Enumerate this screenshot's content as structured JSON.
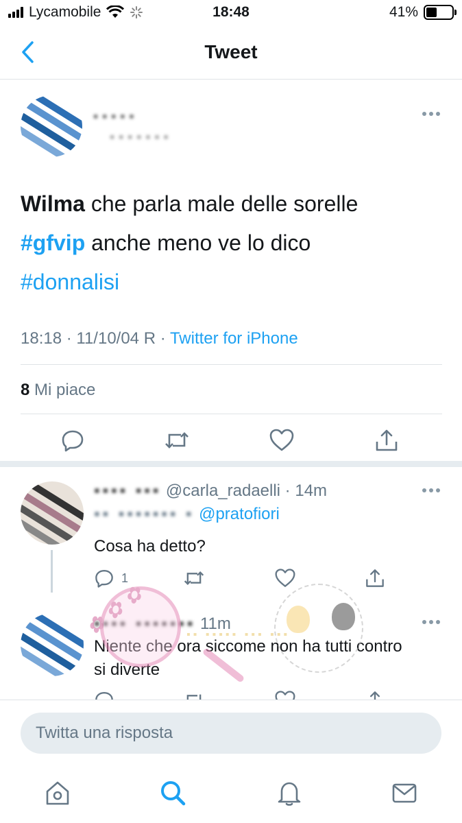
{
  "status_bar": {
    "carrier": "Lycamobile",
    "time": "18:48",
    "battery_percent": "41%",
    "battery_level": 0.41
  },
  "nav": {
    "title": "Tweet"
  },
  "tweet": {
    "text_bold": "Wilma",
    "text_line1_rest": " che parla male delle sorelle",
    "hashtag_gfvip": "#gfvip",
    "text_line2_rest": " anche meno ve lo dico",
    "hashtag_donnalisi": "#donnalisi",
    "timestamp": "18:18 · 11/10/04 R",
    "separator": " · ",
    "source": "Twitter for iPhone",
    "likes_count": "8",
    "likes_label": " Mi piace"
  },
  "replies": [
    {
      "handle": "@carla_radaelli",
      "time_sep": " · ",
      "time": "14m",
      "reply_to_mention": "@pratofiori",
      "text": "Cosa ha detto?",
      "reply_count": "1"
    },
    {
      "time": "11m",
      "text": "Niente che ora siccome non ha tutti contro si diverte"
    }
  ],
  "composer": {
    "placeholder": "Twitta una risposta"
  },
  "tab_bar": {
    "icons": [
      "home-icon",
      "search-icon",
      "notifications-icon",
      "messages-icon"
    ],
    "active": "search-icon"
  },
  "colors": {
    "accent": "#1da1f2",
    "muted": "#657786",
    "divider": "#e6ecf0",
    "text": "#14171a"
  }
}
